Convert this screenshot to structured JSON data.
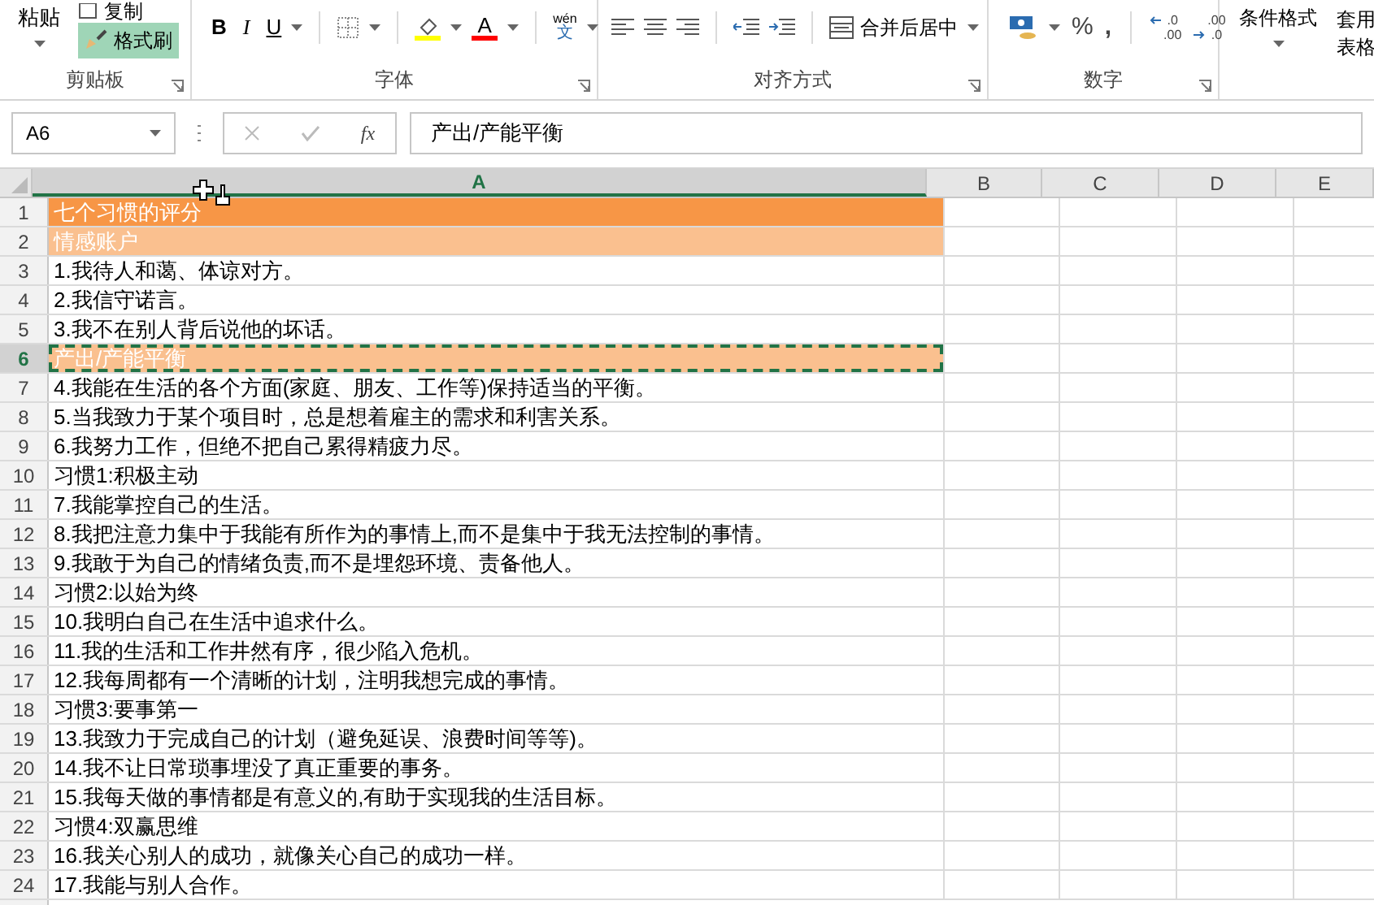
{
  "ribbon": {
    "clipboard": {
      "paste": "粘贴",
      "copy": "复制",
      "format_painter": {
        "label": "格式刷",
        "selected": true
      },
      "label": "剪贴板"
    },
    "font": {
      "bold": "B",
      "italic": "I",
      "underline": "U",
      "font_color_letter": "A",
      "phonetic_top": "wén",
      "phonetic_bottom": "文",
      "label": "字体"
    },
    "alignment": {
      "merge": "合并后居中",
      "label": "对齐方式"
    },
    "number": {
      "percent": "%",
      "comma": ",",
      "increase_top": ".0",
      "increase_bottom": ".00",
      "decrease_top": ".00",
      "decrease_bottom": ".0",
      "label": "数字"
    },
    "styles": {
      "conditional": "条件格式",
      "table_top": "套用",
      "table_bottom": "表格"
    }
  },
  "formula_bar": {
    "name_box": "A6",
    "fx": "fx",
    "value": "产出/产能平衡"
  },
  "columns": [
    {
      "label": "A",
      "selected": true
    },
    {
      "label": "B",
      "selected": false
    },
    {
      "label": "C",
      "selected": false
    },
    {
      "label": "D",
      "selected": false
    },
    {
      "label": "E",
      "selected": false
    }
  ],
  "rows": [
    {
      "number": "1",
      "text": "七个习惯的评分",
      "color": "#f79646",
      "selected": false
    },
    {
      "number": "2",
      "text": "情感账户",
      "color": "#fac08f",
      "selected": false
    },
    {
      "number": "3",
      "text": "1.我待人和蔼、体谅对方。",
      "selected": false
    },
    {
      "number": "4",
      "text": "2.我信守诺言。",
      "selected": false
    },
    {
      "number": "5",
      "text": "3.我不在别人背后说他的坏话。",
      "selected": false
    },
    {
      "number": "6",
      "text": "产出/产能平衡",
      "color": "#fac08f",
      "selected": true
    },
    {
      "number": "7",
      "text": "4.我能在生活的各个方面(家庭、朋友、工作等)保持适当的平衡。",
      "selected": false
    },
    {
      "number": "8",
      "text": "5.当我致力于某个项目时，总是想着雇主的需求和利害关系。",
      "selected": false
    },
    {
      "number": "9",
      "text": "6.我努力工作，但绝不把自己累得精疲力尽。",
      "selected": false
    },
    {
      "number": "10",
      "text": "习惯1:积极主动",
      "selected": false
    },
    {
      "number": "11",
      "text": "7.我能掌控自己的生活。",
      "selected": false
    },
    {
      "number": "12",
      "text": "8.我把注意力集中于我能有所作为的事情上,而不是集中于我无法控制的事情。",
      "selected": false
    },
    {
      "number": "13",
      "text": "9.我敢于为自己的情绪负责,而不是埋怨环境、责备他人。",
      "selected": false
    },
    {
      "number": "14",
      "text": "习惯2:以始为终",
      "selected": false
    },
    {
      "number": "15",
      "text": "10.我明白自己在生活中追求什么。",
      "selected": false
    },
    {
      "number": "16",
      "text": "11.我的生活和工作井然有序，很少陷入危机。",
      "selected": false
    },
    {
      "number": "17",
      "text": "12.我每周都有一个清晰的计划，注明我想完成的事情。",
      "selected": false
    },
    {
      "number": "18",
      "text": "习惯3:要事第一",
      "selected": false
    },
    {
      "number": "19",
      "text": "13.我致力于完成自己的计划（避免延误、浪费时间等等)。",
      "selected": false
    },
    {
      "number": "20",
      "text": "14.我不让日常琐事埋没了真正重要的事务。",
      "selected": false
    },
    {
      "number": "21",
      "text": "15.我每天做的事情都是有意义的,有助于实现我的生活目标。",
      "selected": false
    },
    {
      "number": "22",
      "text": "习惯4:双赢思维",
      "selected": false
    },
    {
      "number": "23",
      "text": "16.我关心别人的成功，就像关心自己的成功一样。",
      "selected": false
    },
    {
      "number": "24",
      "text": "17.我能与别人合作。",
      "selected": false
    }
  ]
}
